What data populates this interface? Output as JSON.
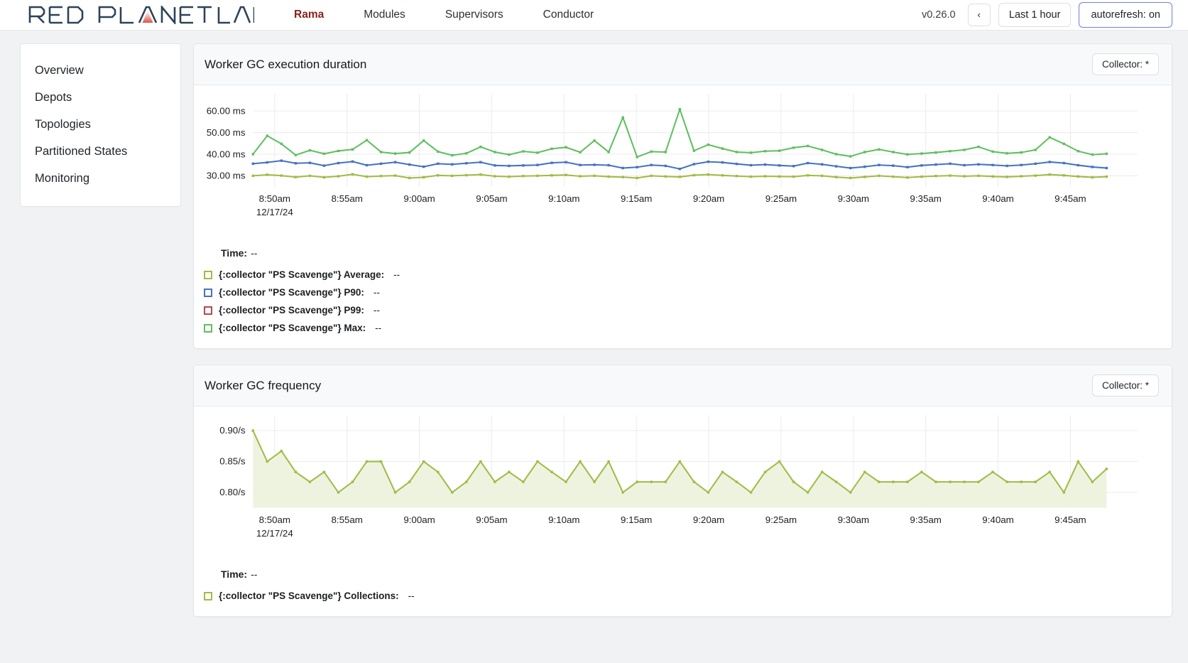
{
  "navbar": {
    "logo_text": "RED PLANET LABS",
    "links": [
      {
        "label": "Rama",
        "active": true
      },
      {
        "label": "Modules",
        "active": false
      },
      {
        "label": "Supervisors",
        "active": false
      },
      {
        "label": "Conductor",
        "active": false
      }
    ],
    "version": "v0.26.0",
    "back_button": "‹",
    "time_range_button": "Last 1 hour",
    "autorefresh_button": "autorefresh: on",
    "accent_active": "#8b1f1f",
    "accent_autorefresh_border": "#6f7ee8"
  },
  "sidebar": {
    "items": [
      {
        "label": "Overview"
      },
      {
        "label": "Depots"
      },
      {
        "label": "Topologies"
      },
      {
        "label": "Partitioned States"
      },
      {
        "label": "Monitoring"
      }
    ]
  },
  "panels": [
    {
      "title": "Worker GC execution duration",
      "collector_button": "Collector: *",
      "time_label": "Time:",
      "time_value": "--",
      "legend": [
        {
          "label": "{:collector \"PS Scavenge\"} Average:",
          "value": "--",
          "color": "#9fbc44"
        },
        {
          "label": "{:collector \"PS Scavenge\"} P90:",
          "value": "--",
          "color": "#4472c4"
        },
        {
          "label": "{:collector \"PS Scavenge\"} P99:",
          "value": "--",
          "color": "#b5494b"
        },
        {
          "label": "{:collector \"PS Scavenge\"} Max:",
          "value": "--",
          "color": "#5fbf5f"
        }
      ]
    },
    {
      "title": "Worker GC frequency",
      "collector_button": "Collector: *",
      "time_label": "Time:",
      "time_value": "--",
      "legend": [
        {
          "label": "{:collector \"PS Scavenge\"} Collections:",
          "value": "--",
          "color": "#9fbc44"
        }
      ]
    }
  ],
  "chart_data": [
    {
      "type": "line",
      "title": "Worker GC execution duration",
      "xlabel": "",
      "ylabel": "",
      "ylim": [
        25,
        65
      ],
      "yticks": [
        30,
        40,
        50,
        60
      ],
      "ytick_labels": [
        "30.00 ms",
        "40.00 ms",
        "50.00 ms",
        "60.00 ms"
      ],
      "xtick_labels": [
        "8:50am",
        "8:55am",
        "9:00am",
        "9:05am",
        "9:10am",
        "9:15am",
        "9:20am",
        "9:25am",
        "9:30am",
        "9:35am",
        "9:40am",
        "9:45am"
      ],
      "x_sub_label": "12/17/24",
      "grid": true,
      "legend_position": "below",
      "series": [
        {
          "name": "{:collector \"PS Scavenge\"} Max",
          "color": "#5fbf5f",
          "values": [
            40.0,
            48.5,
            44.8,
            39.6,
            41.8,
            40.2,
            41.5,
            42.2,
            46.5,
            41.0,
            40.3,
            40.8,
            46.3,
            41.2,
            39.5,
            40.4,
            43.4,
            41.0,
            39.8,
            41.3,
            40.7,
            42.5,
            43.2,
            40.9,
            46.3,
            41.0,
            57.0,
            38.7,
            41.2,
            41.0,
            60.8,
            41.6,
            44.4,
            42.6,
            41.0,
            40.7,
            41.4,
            41.6,
            43.0,
            43.8,
            42.0,
            40.0,
            39.0,
            41.0,
            42.2,
            41.0,
            39.9,
            40.3,
            40.8,
            41.4,
            42.0,
            43.4,
            41.2,
            40.4,
            40.8,
            42.0,
            47.8,
            44.8,
            41.4,
            39.8,
            40.2
          ]
        },
        {
          "name": "{:collector \"PS Scavenge\"} P90",
          "color": "#4472c4",
          "values": [
            35.6,
            36.2,
            37.0,
            35.8,
            36.0,
            34.7,
            35.9,
            36.6,
            34.9,
            35.6,
            36.3,
            35.2,
            34.2,
            35.6,
            35.3,
            35.8,
            36.3,
            34.8,
            34.6,
            34.8,
            35.0,
            36.0,
            36.3,
            35.0,
            35.1,
            34.9,
            33.6,
            34.0,
            35.0,
            34.6,
            33.2,
            35.4,
            36.5,
            36.2,
            35.5,
            34.9,
            35.2,
            34.8,
            34.5,
            35.9,
            35.3,
            34.4,
            33.6,
            34.2,
            35.0,
            34.7,
            34.0,
            34.8,
            35.2,
            35.6,
            34.9,
            35.3,
            35.0,
            34.6,
            35.0,
            35.6,
            36.4,
            35.9,
            34.9,
            34.1,
            33.6
          ]
        },
        {
          "name": "{:collector \"PS Scavenge\"} Average",
          "color": "#9fbc44",
          "values": [
            30.0,
            30.5,
            30.1,
            29.4,
            30.0,
            29.3,
            29.8,
            30.7,
            29.6,
            29.9,
            30.1,
            29.0,
            29.3,
            30.2,
            30.0,
            30.3,
            30.6,
            29.8,
            29.6,
            29.9,
            30.0,
            30.2,
            30.4,
            29.8,
            30.0,
            29.6,
            29.4,
            29.0,
            30.0,
            29.7,
            29.5,
            30.3,
            30.6,
            30.2,
            29.9,
            29.6,
            29.8,
            29.7,
            29.6,
            30.2,
            30.0,
            29.4,
            29.0,
            29.5,
            30.0,
            29.6,
            29.2,
            29.6,
            29.9,
            30.1,
            29.8,
            30.0,
            29.7,
            29.5,
            29.8,
            30.1,
            30.6,
            30.2,
            29.7,
            29.3,
            29.6
          ]
        },
        {
          "name": "{:collector \"PS Scavenge\"} P99",
          "color": "#b5494b",
          "values": []
        }
      ]
    },
    {
      "type": "area",
      "title": "Worker GC frequency",
      "xlabel": "",
      "ylabel": "",
      "ylim": [
        0.775,
        0.915
      ],
      "yticks": [
        0.8,
        0.85,
        0.9
      ],
      "ytick_labels": [
        "0.80/s",
        "0.85/s",
        "0.90/s"
      ],
      "xtick_labels": [
        "8:50am",
        "8:55am",
        "9:00am",
        "9:05am",
        "9:10am",
        "9:15am",
        "9:20am",
        "9:25am",
        "9:30am",
        "9:35am",
        "9:40am",
        "9:45am"
      ],
      "x_sub_label": "12/17/24",
      "grid": true,
      "legend_position": "below",
      "series": [
        {
          "name": "{:collector \"PS Scavenge\"} Collections",
          "color": "#9fbc44",
          "fill": "#eef3e0",
          "values": [
            0.9,
            0.85,
            0.867,
            0.833,
            0.817,
            0.833,
            0.8,
            0.817,
            0.85,
            0.85,
            0.8,
            0.817,
            0.85,
            0.833,
            0.8,
            0.817,
            0.85,
            0.817,
            0.833,
            0.817,
            0.85,
            0.833,
            0.817,
            0.85,
            0.817,
            0.85,
            0.8,
            0.817,
            0.817,
            0.817,
            0.85,
            0.817,
            0.8,
            0.833,
            0.817,
            0.8,
            0.833,
            0.85,
            0.817,
            0.8,
            0.833,
            0.817,
            0.8,
            0.833,
            0.817,
            0.817,
            0.817,
            0.833,
            0.817,
            0.817,
            0.817,
            0.817,
            0.833,
            0.817,
            0.817,
            0.817,
            0.833,
            0.8,
            0.85,
            0.817,
            0.838
          ]
        }
      ]
    }
  ]
}
